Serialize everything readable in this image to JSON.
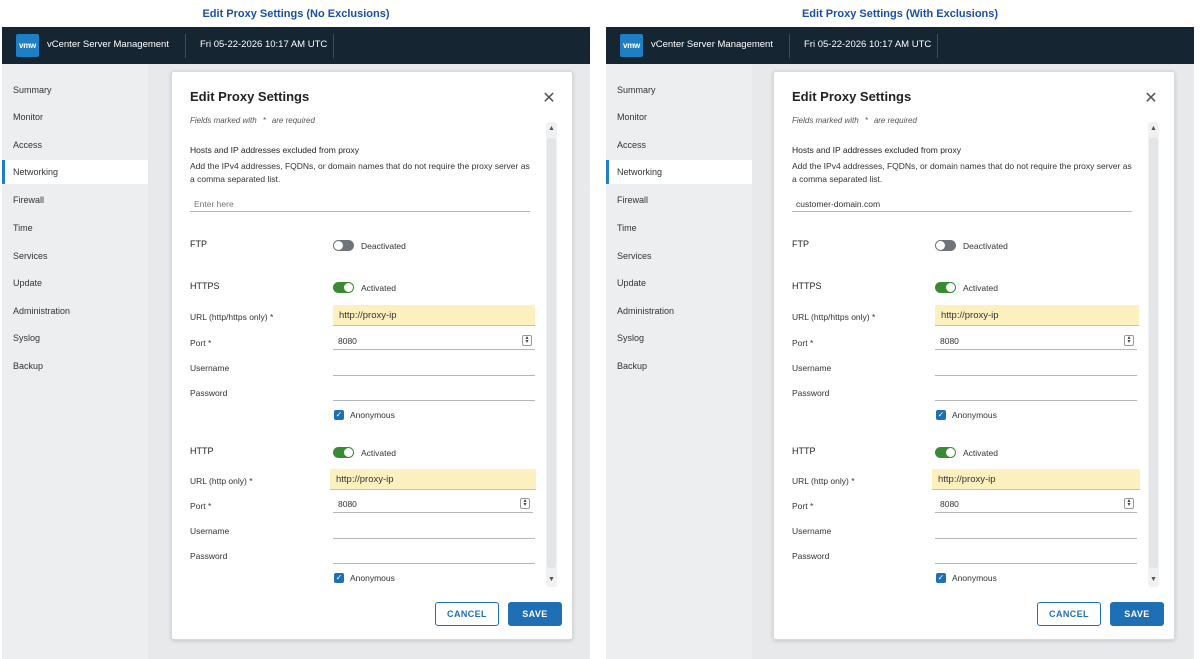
{
  "captions": {
    "left": "Edit Proxy Settings (No Exclusions)",
    "right": "Edit Proxy Settings (With Exclusions)"
  },
  "topbar": {
    "logo": "vmw",
    "app_title": "vCenter Server Management",
    "datetime": "Fri 05-22-2026 10:17 AM UTC"
  },
  "sidebar": {
    "items": [
      {
        "label": "Summary"
      },
      {
        "label": "Monitor"
      },
      {
        "label": "Access"
      },
      {
        "label": "Networking"
      },
      {
        "label": "Firewall"
      },
      {
        "label": "Time"
      },
      {
        "label": "Services"
      },
      {
        "label": "Update"
      },
      {
        "label": "Administration"
      },
      {
        "label": "Syslog"
      },
      {
        "label": "Backup"
      }
    ],
    "active": "Networking"
  },
  "dialog": {
    "title": "Edit Proxy Settings",
    "close_icon": "close-icon",
    "required_note_prefix": "Fields marked with",
    "required_star": "*",
    "required_note_suffix": "are required",
    "exclusions_label": "Hosts and IP addresses excluded from proxy",
    "exclusions_help": "Add the IPv4 addresses, FQDNs, or domain names that do not require the proxy server as a comma separated list.",
    "exclusions_placeholder": "Enter here",
    "exclusions_value_left": "",
    "exclusions_value_right": "customer-domain.com",
    "ftp": {
      "label": "FTP",
      "state": "Deactivated"
    },
    "https": {
      "label": "HTTPS",
      "state": "Activated",
      "url_label": "URL (http/https only) *",
      "url_value": "http://proxy-ip",
      "port_label": "Port *",
      "port_value": "8080",
      "username_label": "Username",
      "password_label": "Password",
      "anonymous_label": "Anonymous"
    },
    "http": {
      "label": "HTTP",
      "state": "Activated",
      "url_label": "URL (http only) *",
      "url_value": "http://proxy-ip",
      "port_label": "Port *",
      "port_value": "8080",
      "username_label": "Username",
      "password_label": "Password",
      "anonymous_label": "Anonymous"
    },
    "cancel_label": "CANCEL",
    "save_label": "SAVE"
  },
  "colors": {
    "topbar": "#162532",
    "accent": "#1f6fb5",
    "toggle_on": "#3a8a34",
    "toggle_off": "#6f747a",
    "url_highlight": "#fdf0bf",
    "caption": "#1a4fa3"
  }
}
